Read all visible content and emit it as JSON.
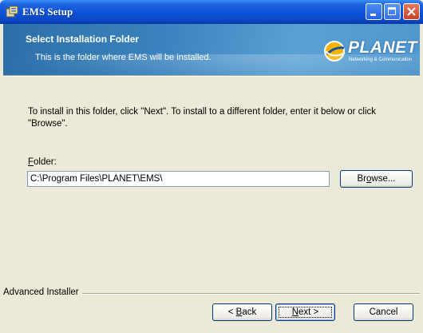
{
  "window": {
    "title": "EMS Setup",
    "icon": "installer-icon",
    "controls": [
      "minimize-icon",
      "maximize-icon",
      "close-icon"
    ]
  },
  "banner": {
    "title": "Select Installation Folder",
    "subtitle": "This is the folder where EMS will be installed.",
    "logo_text": "PLANET",
    "logo_tagline": "Networking & Communication"
  },
  "body": {
    "instruction": "To install in this folder, click \"Next\". To install to a different folder, enter it below or click \"Browse\".",
    "folder_label_mnemonic": "F",
    "folder_label_rest": "older:",
    "folder_value": "C:\\Program Files\\PLANET\\EMS\\",
    "browse_pre": "Br",
    "browse_mnemonic": "o",
    "browse_post": "wse..."
  },
  "footer": {
    "brand": "Advanced Installer",
    "back_pre": "< ",
    "back_mnemonic": "B",
    "back_post": "ack",
    "next_mnemonic": "N",
    "next_post": "ext >",
    "cancel_label": "Cancel"
  },
  "colors": {
    "titlebar": "#0a52d9",
    "banner": "#3c84bf",
    "dialog_bg": "#ece9d8"
  }
}
